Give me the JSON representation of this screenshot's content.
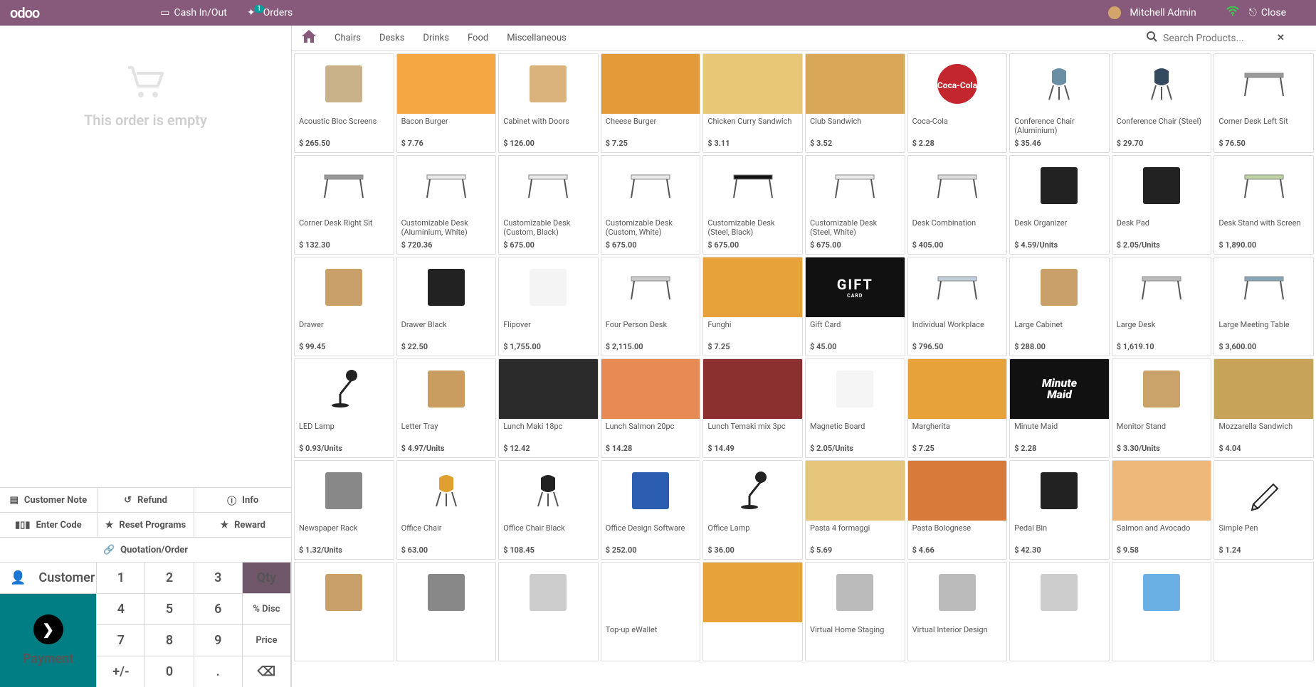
{
  "header": {
    "logo": "odoo",
    "cash_in_out": "Cash In/Out",
    "orders": "Orders",
    "orders_badge": "1",
    "user": "Mitchell Admin",
    "close": "Close"
  },
  "left_panel": {
    "empty_text": "This order is empty",
    "actions": {
      "customer_note": "Customer Note",
      "refund": "Refund",
      "info": "Info",
      "enter_code": "Enter Code",
      "reset_programs": "Reset Programs",
      "reward": "Reward",
      "quotation_order": "Quotation/Order"
    },
    "customer": "Customer",
    "payment": "Payment",
    "keypad": {
      "1": "1",
      "2": "2",
      "3": "3",
      "4": "4",
      "5": "5",
      "6": "6",
      "7": "7",
      "8": "8",
      "9": "9",
      "0": "0",
      "plus_minus": "+/-",
      "dot": ".",
      "qty": "Qty",
      "disc": "% Disc",
      "price": "Price"
    }
  },
  "categories": {
    "home": "home",
    "tabs": [
      "Chairs",
      "Desks",
      "Drinks",
      "Food",
      "Miscellaneous"
    ]
  },
  "search": {
    "placeholder": "Search Products..."
  },
  "products": [
    {
      "name": "Acoustic Bloc Screens",
      "price": "$ 265.50",
      "color": "#c9b28a",
      "type": "box"
    },
    {
      "name": "Bacon Burger",
      "price": "$ 7.76",
      "color": "#f4a742",
      "type": "food"
    },
    {
      "name": "Cabinet with Doors",
      "price": "$ 126.00",
      "color": "#d9b27c",
      "type": "box"
    },
    {
      "name": "Cheese Burger",
      "price": "$ 7.25",
      "color": "#e59a3a",
      "type": "food"
    },
    {
      "name": "Chicken Curry Sandwich",
      "price": "$ 3.11",
      "color": "#e8c777",
      "type": "food"
    },
    {
      "name": "Club Sandwich",
      "price": "$ 3.52",
      "color": "#d8a858",
      "type": "food"
    },
    {
      "name": "Coca-Cola",
      "price": "$ 2.28",
      "color": "#c4262e",
      "type": "circle"
    },
    {
      "name": "Conference Chair (Aluminium)",
      "price": "$ 35.46",
      "color": "#6a8fa5",
      "type": "chair"
    },
    {
      "name": "Conference Chair (Steel)",
      "price": "$ 29.70",
      "color": "#334a5e",
      "type": "chair"
    },
    {
      "name": "Corner Desk Left Sit",
      "price": "$ 76.50",
      "color": "#999",
      "type": "desk"
    },
    {
      "name": "Corner Desk Right Sit",
      "price": "$ 132.30",
      "color": "#999",
      "type": "desk"
    },
    {
      "name": "Customizable Desk (Aluminium, White)",
      "price": "$ 720.36",
      "color": "#eaeaea",
      "type": "desk"
    },
    {
      "name": "Customizable Desk (Custom, Black)",
      "price": "$ 675.00",
      "color": "#eaeaea",
      "type": "desk"
    },
    {
      "name": "Customizable Desk (Custom, White)",
      "price": "$ 675.00",
      "color": "#eaeaea",
      "type": "desk"
    },
    {
      "name": "Customizable Desk (Steel, Black)",
      "price": "$ 675.00",
      "color": "#111",
      "type": "desk"
    },
    {
      "name": "Customizable Desk (Steel, White)",
      "price": "$ 675.00",
      "color": "#eaeaea",
      "type": "desk"
    },
    {
      "name": "Desk Combination",
      "price": "$ 405.00",
      "color": "#ddd",
      "type": "desk"
    },
    {
      "name": "Desk Organizer",
      "price": "$ 4.59/Units",
      "color": "#222",
      "type": "box"
    },
    {
      "name": "Desk Pad",
      "price": "$ 2.05/Units",
      "color": "#222",
      "type": "box"
    },
    {
      "name": "Desk Stand with Screen",
      "price": "$ 1,890.00",
      "color": "#bdd3a3",
      "type": "desk"
    },
    {
      "name": "Drawer",
      "price": "$ 99.45",
      "color": "#c9a06a",
      "type": "box"
    },
    {
      "name": "Drawer Black",
      "price": "$ 22.50",
      "color": "#222",
      "type": "box"
    },
    {
      "name": "Flipover",
      "price": "$ 1,755.00",
      "color": "#f4f4f4",
      "type": "box"
    },
    {
      "name": "Four Person Desk",
      "price": "$ 2,115.00",
      "color": "#ccc",
      "type": "desk"
    },
    {
      "name": "Funghi",
      "price": "$ 7.25",
      "color": "#e8a23a",
      "type": "food"
    },
    {
      "name": "Gift Card",
      "price": "$ 45.00",
      "color": "#111",
      "type": "gift"
    },
    {
      "name": "Individual Workplace",
      "price": "$ 796.50",
      "color": "#c0d0dc",
      "type": "desk"
    },
    {
      "name": "Large Cabinet",
      "price": "$ 288.00",
      "color": "#c9a06a",
      "type": "box"
    },
    {
      "name": "Large Desk",
      "price": "$ 1,619.10",
      "color": "#bbb",
      "type": "desk"
    },
    {
      "name": "Large Meeting Table",
      "price": "$ 3,600.00",
      "color": "#8aa7b8",
      "type": "desk"
    },
    {
      "name": "LED Lamp",
      "price": "$ 0.93/Units",
      "color": "#222",
      "type": "lamp"
    },
    {
      "name": "Letter Tray",
      "price": "$ 4.97/Units",
      "color": "#c99d60",
      "type": "box"
    },
    {
      "name": "Lunch Maki 18pc",
      "price": "$ 12.42",
      "color": "#2b2b2b",
      "type": "food"
    },
    {
      "name": "Lunch Salmon 20pc",
      "price": "$ 14.28",
      "color": "#e78a54",
      "type": "food"
    },
    {
      "name": "Lunch Temaki mix 3pc",
      "price": "$ 14.49",
      "color": "#8b2f2f",
      "type": "food"
    },
    {
      "name": "Magnetic Board",
      "price": "$ 2.05/Units",
      "color": "#f5f5f5",
      "type": "box"
    },
    {
      "name": "Margherita",
      "price": "$ 7.25",
      "color": "#e8a23a",
      "type": "food"
    },
    {
      "name": "Minute Maid",
      "price": "$ 2.28",
      "color": "#111",
      "type": "minute"
    },
    {
      "name": "Monitor Stand",
      "price": "$ 3.30/Units",
      "color": "#caa36a",
      "type": "box"
    },
    {
      "name": "Mozzarella Sandwich",
      "price": "$ 4.04",
      "color": "#c7a35a",
      "type": "food"
    },
    {
      "name": "Newspaper Rack",
      "price": "$ 1.32/Units",
      "color": "#888",
      "type": "box"
    },
    {
      "name": "Office Chair",
      "price": "$ 63.00",
      "color": "#e0a030",
      "type": "chair"
    },
    {
      "name": "Office Chair Black",
      "price": "$ 108.45",
      "color": "#222",
      "type": "chair"
    },
    {
      "name": "Office Design Software",
      "price": "$ 252.00",
      "color": "#2a5db0",
      "type": "box"
    },
    {
      "name": "Office Lamp",
      "price": "$ 36.00",
      "color": "#222",
      "type": "lamp"
    },
    {
      "name": "Pasta 4 formaggi",
      "price": "$ 5.69",
      "color": "#e6c67a",
      "type": "food"
    },
    {
      "name": "Pasta Bolognese",
      "price": "$ 4.66",
      "color": "#d77a3a",
      "type": "food"
    },
    {
      "name": "Pedal Bin",
      "price": "$ 42.30",
      "color": "#222",
      "type": "box"
    },
    {
      "name": "Salmon and Avocado",
      "price": "$ 9.58",
      "color": "#eeb879",
      "type": "food"
    },
    {
      "name": "Simple Pen",
      "price": "$ 1.24",
      "color": "#111",
      "type": "pen"
    },
    {
      "name": "",
      "price": "",
      "color": "#c9a06a",
      "type": "box"
    },
    {
      "name": "",
      "price": "",
      "color": "#888",
      "type": "box"
    },
    {
      "name": "",
      "price": "",
      "color": "#ccc",
      "type": "box"
    },
    {
      "name": "Top-up eWallet",
      "price": "",
      "color": "#fff",
      "type": "blank"
    },
    {
      "name": "",
      "price": "",
      "color": "#e8a23a",
      "type": "food"
    },
    {
      "name": "Virtual Home Staging",
      "price": "",
      "color": "#bbb",
      "type": "box"
    },
    {
      "name": "Virtual Interior Design",
      "price": "",
      "color": "#bbb",
      "type": "box"
    },
    {
      "name": "",
      "price": "",
      "color": "#ccc",
      "type": "box"
    },
    {
      "name": "",
      "price": "",
      "color": "#6ab0e4",
      "type": "box"
    },
    {
      "name": "",
      "price": "",
      "color": "#fff",
      "type": "blank"
    }
  ]
}
